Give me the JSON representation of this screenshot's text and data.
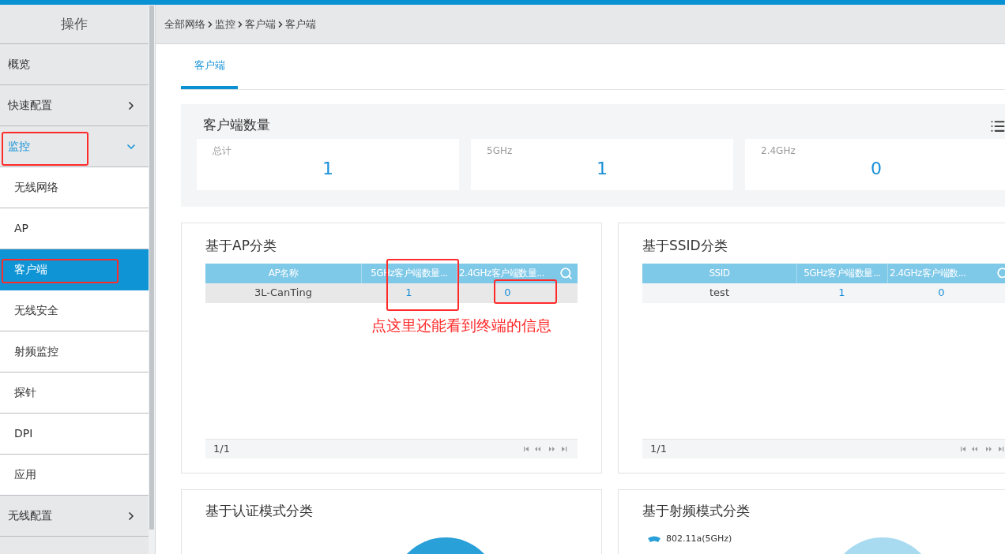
{
  "sidebar": {
    "title": "操作",
    "items": [
      {
        "kind": "link",
        "label": "概览",
        "highlighted": false
      },
      {
        "kind": "group",
        "label": "快速配置",
        "expanded": false,
        "highlighted": false
      },
      {
        "kind": "group",
        "label": "监控",
        "expanded": true,
        "highlighted": true,
        "children": [
          {
            "label": "无线网络",
            "selected": false,
            "highlighted": false
          },
          {
            "label": "AP",
            "selected": false,
            "highlighted": false
          },
          {
            "label": "客户端",
            "selected": true,
            "highlighted": true
          },
          {
            "label": "无线安全",
            "selected": false,
            "highlighted": false
          },
          {
            "label": "射频监控",
            "selected": false,
            "highlighted": false
          },
          {
            "label": "探针",
            "selected": false,
            "highlighted": false
          },
          {
            "label": "DPI",
            "selected": false,
            "highlighted": false
          },
          {
            "label": "应用",
            "selected": false,
            "highlighted": false
          }
        ]
      },
      {
        "kind": "group",
        "label": "无线配置",
        "expanded": false,
        "highlighted": false
      }
    ]
  },
  "breadcrumb": [
    "全部网络",
    "监控",
    "客户端",
    "客户端"
  ],
  "tabs": [
    {
      "label": "客户端",
      "selected": true
    }
  ],
  "client_count": {
    "title": "客户端数量",
    "stats": [
      {
        "label": "总计",
        "value": "1"
      },
      {
        "label": "5GHz",
        "value": "1"
      },
      {
        "label": "2.4GHz",
        "value": "0"
      }
    ]
  },
  "table_panels": [
    {
      "title": "基于AP分类",
      "columns": [
        {
          "label": "AP名称",
          "highlighted": false
        },
        {
          "label": "5GHz客户端数量...",
          "highlighted": true
        },
        {
          "label": "2.4GHz客户端数量...",
          "highlighted": false
        }
      ],
      "rows": [
        {
          "selected": true,
          "cells": [
            {
              "kind": "text",
              "text": "3L-CanTing",
              "highlighted": false
            },
            {
              "kind": "link",
              "text": "1",
              "highlighted": false
            },
            {
              "kind": "link",
              "text": "0",
              "highlighted": true
            }
          ]
        }
      ],
      "note": "点这里还能看到终端的信息",
      "pager": "1/1"
    },
    {
      "title": "基于SSID分类",
      "columns": [
        {
          "label": "SSID",
          "highlighted": false
        },
        {
          "label": "5GHz客户端数量...",
          "highlighted": false
        },
        {
          "label": "2.4GHz客户端数...",
          "highlighted": false
        }
      ],
      "rows": [
        {
          "selected": false,
          "cells": [
            {
              "kind": "text",
              "text": "test",
              "highlighted": false
            },
            {
              "kind": "link",
              "text": "1",
              "highlighted": false
            },
            {
              "kind": "link",
              "text": "0",
              "highlighted": false
            }
          ]
        }
      ],
      "pager": "1/1"
    }
  ],
  "chart_panels": [
    {
      "title": "基于认证模式分类"
    },
    {
      "title": "基于射频模式分类",
      "legend": [
        {
          "label": "802.11a(5GHz)",
          "color": "#2aa0d8"
        }
      ]
    }
  ]
}
